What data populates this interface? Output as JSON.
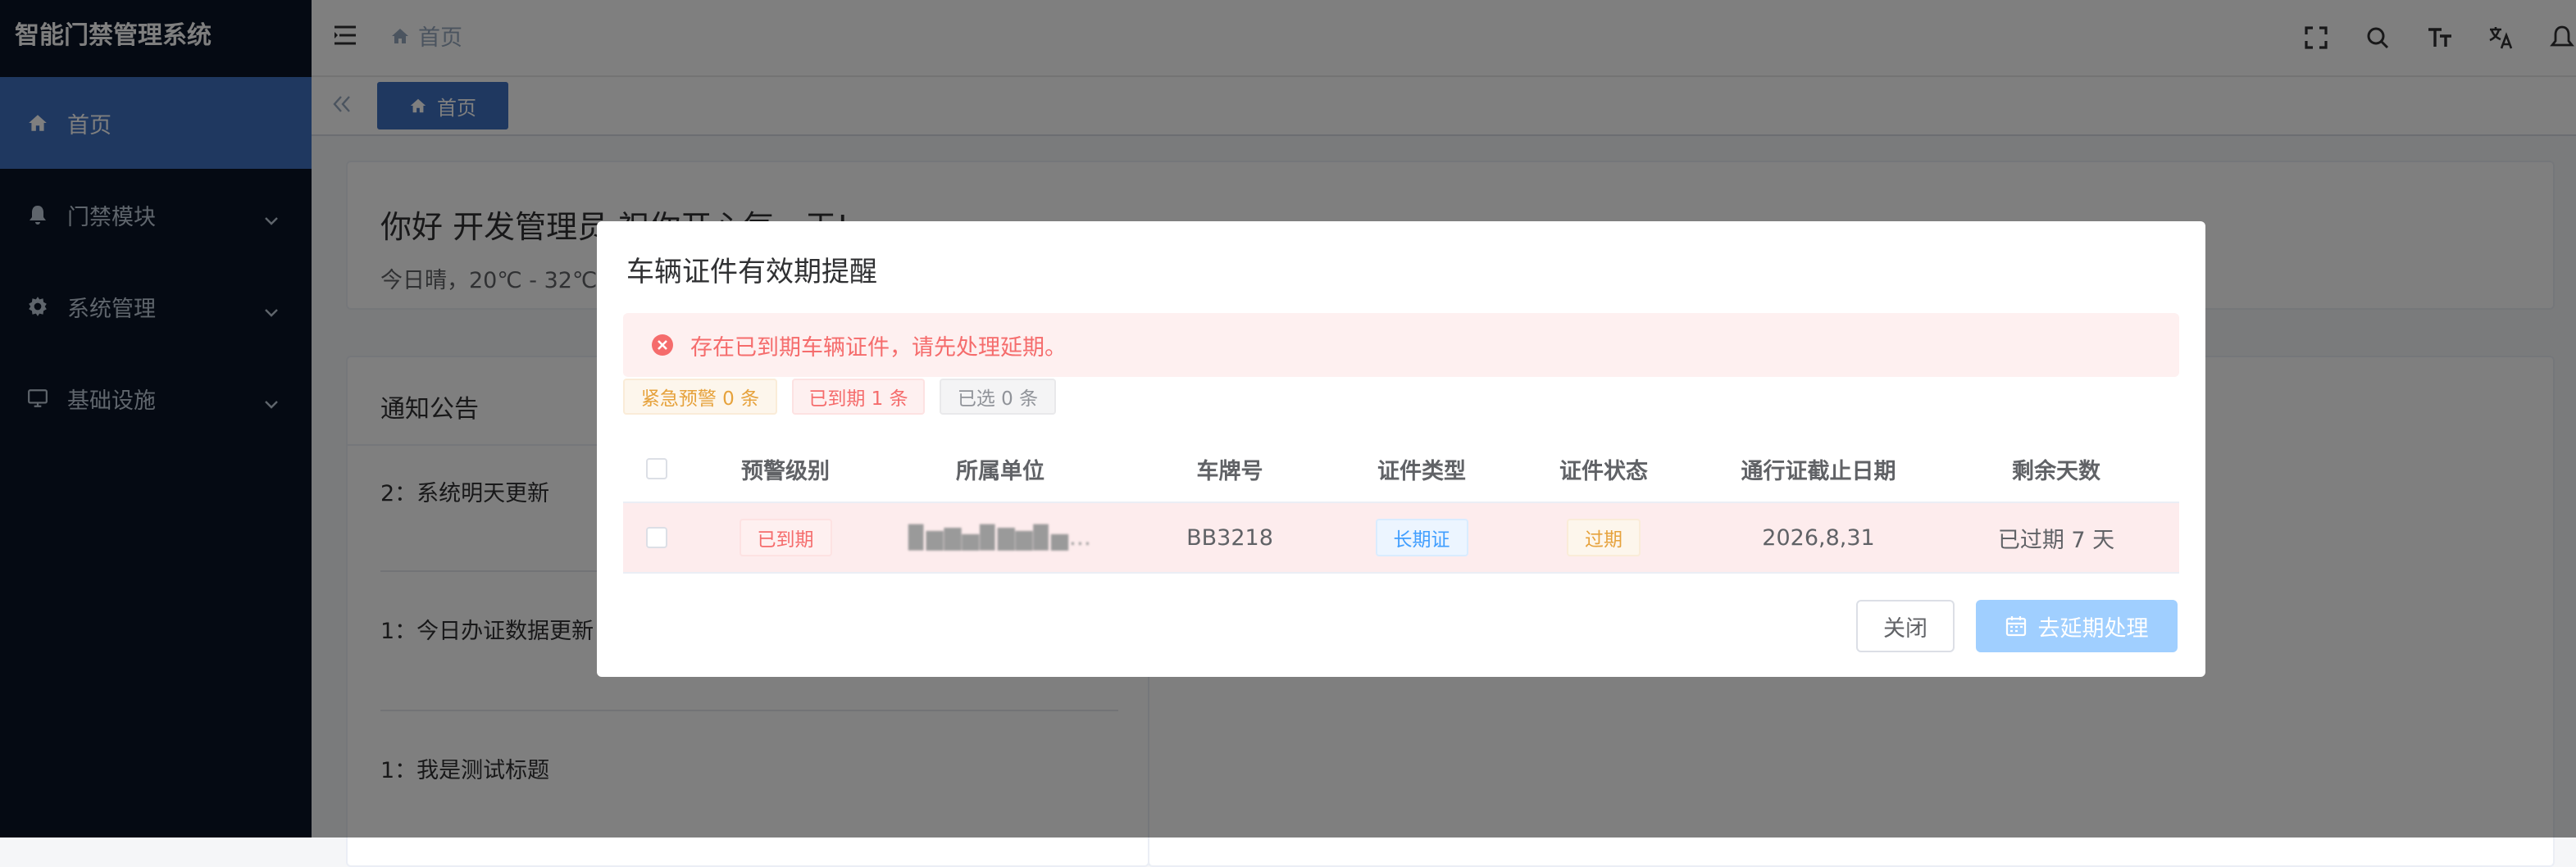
{
  "app": {
    "title": "智能门禁管理系统"
  },
  "sidebar": {
    "items": [
      {
        "label": "首页",
        "icon": "home-icon",
        "active": true
      },
      {
        "label": "门禁模块",
        "icon": "bell-icon",
        "expandable": true
      },
      {
        "label": "系统管理",
        "icon": "gear-icon",
        "expandable": true
      },
      {
        "label": "基础设施",
        "icon": "monitor-icon",
        "expandable": true
      }
    ]
  },
  "navbar": {
    "breadcrumb": "首页",
    "icons": [
      "fullscreen-icon",
      "search-icon",
      "font-size-icon",
      "translate-icon",
      "notification-bell-icon"
    ]
  },
  "tags": {
    "items": [
      {
        "label": "首页"
      }
    ]
  },
  "dashboard": {
    "greeting": "你好 开发管理员 祝你开心每一天!",
    "weather": "今日晴，20℃ - 32℃",
    "notice": {
      "title": "通知公告",
      "items": [
        "2：系统明天更新",
        "1：今日办证数据更新",
        "1：我是测试标题"
      ]
    }
  },
  "dialog": {
    "title": "车辆证件有效期提醒",
    "alert": "存在已到期车辆证件，请先处理延期。",
    "badges": {
      "warning": "紧急预警 0 条",
      "expired": "已到期 1 条",
      "selected": "已选 0 条"
    },
    "columns": [
      "预警级别",
      "所属单位",
      "车牌号",
      "证件类型",
      "证件状态",
      "通行证截止日期",
      "剩余天数"
    ],
    "rows": [
      {
        "level": "已到期",
        "unit": "▉▆▇▅▉▇▆▉▅…",
        "plate": "BB3218",
        "cert_type": "长期证",
        "cert_status": "过期",
        "end_date": "2026,8,31",
        "remaining": "已过期 7 天"
      }
    ],
    "buttons": {
      "close": "关闭",
      "extend": "去延期处理"
    }
  },
  "colors": {
    "sidebar_bg": "#0b1526",
    "accent": "#3e70c0",
    "danger": "#f56c6c",
    "warning": "#e6a23c",
    "primary": "#409eff"
  }
}
